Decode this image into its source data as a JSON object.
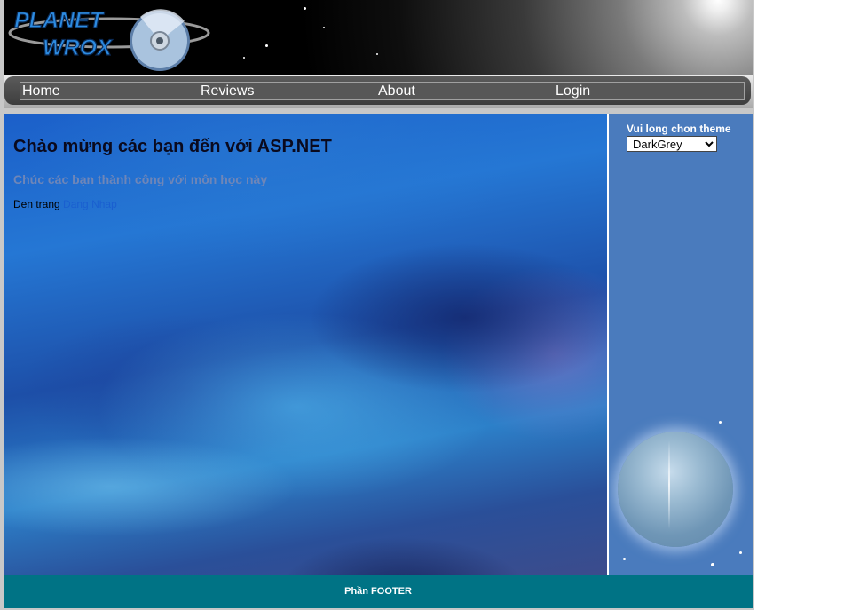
{
  "header": {
    "logo_line1": "PLANET",
    "logo_line2": "WROX"
  },
  "menu": {
    "items": [
      {
        "label": "Home"
      },
      {
        "label": "Reviews"
      },
      {
        "label": "About"
      },
      {
        "label": "Login"
      }
    ]
  },
  "main": {
    "title": "Chào mừng các bạn đến với ASP.NET",
    "subtitle": "Chúc các bạn thành công với môn học này",
    "login_prefix": "Den trang ",
    "login_link": "Dang Nhap"
  },
  "sidebar": {
    "theme_label": "Vui long chon theme",
    "theme_selected": "DarkGrey"
  },
  "footer": {
    "text": "Phần FOOTER"
  },
  "colors": {
    "footer_bg": "#007385",
    "sidebar_bg": "#4a7bbd",
    "menu_bg": "#575757",
    "link": "#1a5fd0"
  }
}
